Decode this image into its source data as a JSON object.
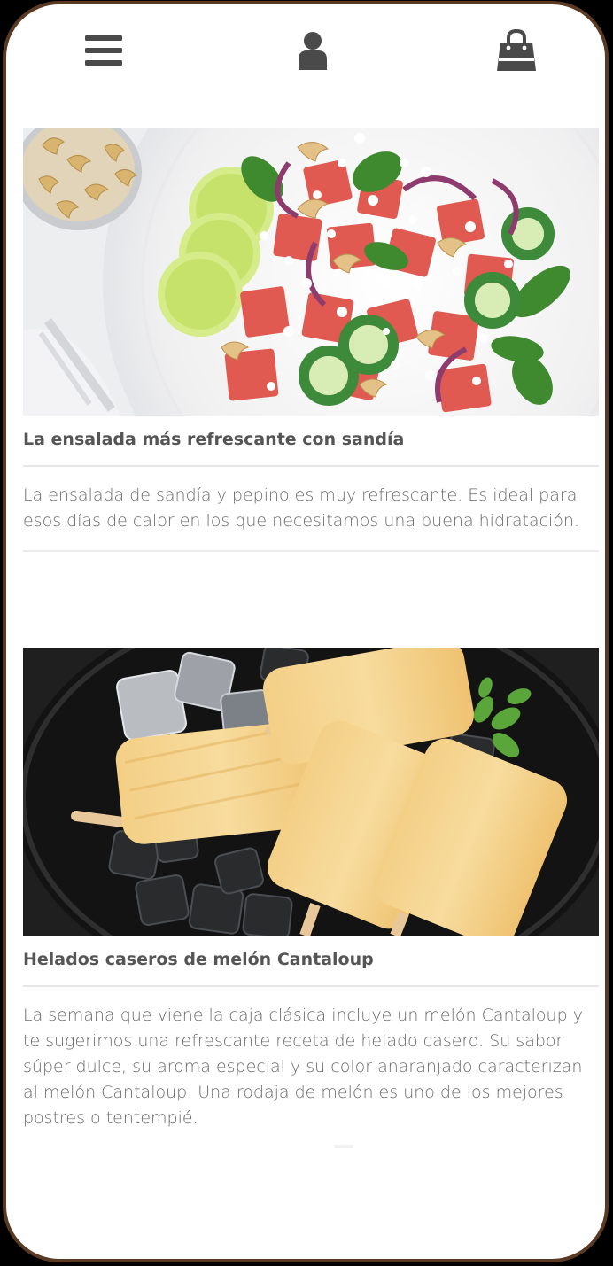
{
  "nav": {
    "menu_icon": "menu-icon",
    "user_icon": "user-icon",
    "cart_icon": "shopping-bag-icon",
    "icon_color": "#4a4a4a"
  },
  "posts": [
    {
      "title": "La ensalada más refrescante con sandía",
      "text": "La ensalada de sandía y pepino es muy refrescante. Es ideal para esos días de calor en los que necesitamos una buena hidratación."
    },
    {
      "title": "Helados caseros de melón Cantaloup",
      "text": "La semana que viene la caja clásica incluye un melón Cantaloup y te sugerimos una refrescante receta de helado casero. Su sabor súper dulce, su aroma especial y su color anaranjado caracterizan al melón Cantaloup. Una rodaja de melón es uno de los mejores postres o tentempié."
    }
  ],
  "colors": {
    "frame": "#5a3a23",
    "title": "#555555",
    "body_text": "#6a6a6a"
  }
}
